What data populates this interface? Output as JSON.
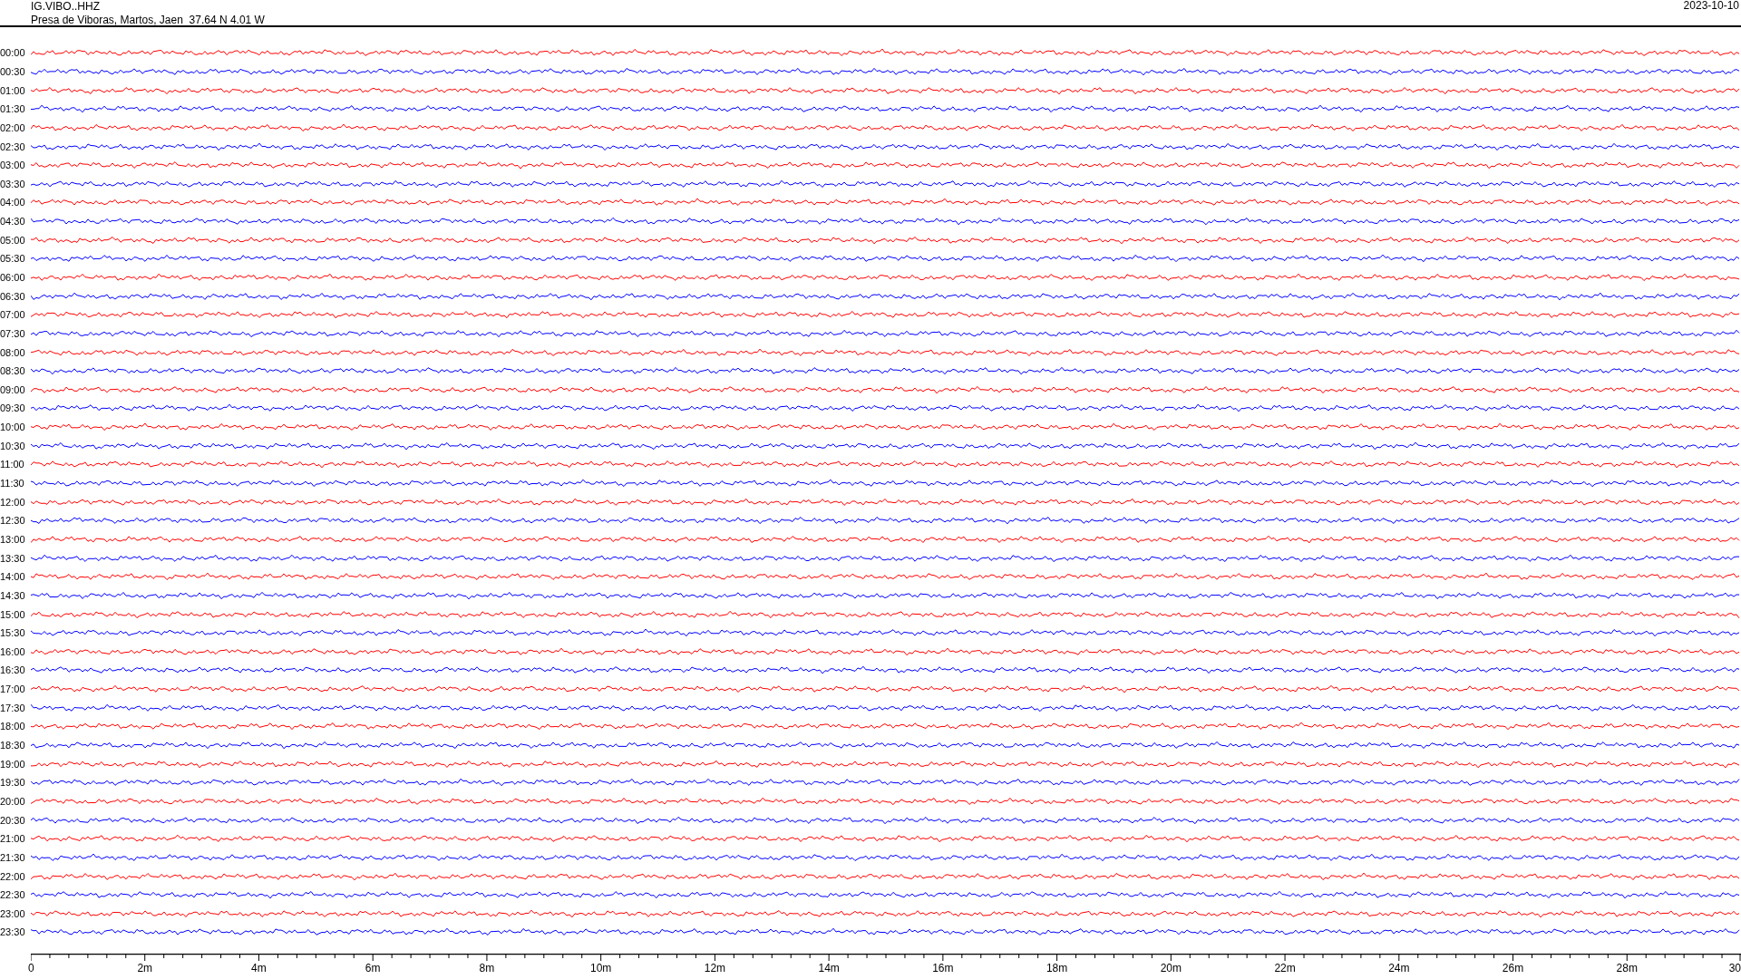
{
  "header": {
    "station": "IG.VIBO..HHZ",
    "location": "Presa de Viboras, Martos, Jaen  37.64 N 4.01 W",
    "date": "2023-10-10"
  },
  "rows": [
    {
      "time": "00:00",
      "color": "#ff0000"
    },
    {
      "time": "00:30",
      "color": "#0000ff"
    },
    {
      "time": "01:00",
      "color": "#ff0000"
    },
    {
      "time": "01:30",
      "color": "#0000ff"
    },
    {
      "time": "02:00",
      "color": "#ff0000"
    },
    {
      "time": "02:30",
      "color": "#0000ff"
    },
    {
      "time": "03:00",
      "color": "#ff0000"
    },
    {
      "time": "03:30",
      "color": "#0000ff"
    },
    {
      "time": "04:00",
      "color": "#ff0000"
    },
    {
      "time": "04:30",
      "color": "#0000ff"
    },
    {
      "time": "05:00",
      "color": "#ff0000"
    },
    {
      "time": "05:30",
      "color": "#0000ff"
    },
    {
      "time": "06:00",
      "color": "#ff0000"
    },
    {
      "time": "06:30",
      "color": "#0000ff"
    },
    {
      "time": "07:00",
      "color": "#ff0000"
    },
    {
      "time": "07:30",
      "color": "#0000ff"
    },
    {
      "time": "08:00",
      "color": "#ff0000"
    },
    {
      "time": "08:30",
      "color": "#0000ff"
    },
    {
      "time": "09:00",
      "color": "#ff0000"
    },
    {
      "time": "09:30",
      "color": "#0000ff"
    },
    {
      "time": "10:00",
      "color": "#ff0000"
    },
    {
      "time": "10:30",
      "color": "#0000ff"
    },
    {
      "time": "11:00",
      "color": "#ff0000"
    },
    {
      "time": "11:30",
      "color": "#0000ff"
    },
    {
      "time": "12:00",
      "color": "#ff0000"
    },
    {
      "time": "12:30",
      "color": "#0000ff"
    },
    {
      "time": "13:00",
      "color": "#ff0000"
    },
    {
      "time": "13:30",
      "color": "#0000ff"
    },
    {
      "time": "14:00",
      "color": "#ff0000"
    },
    {
      "time": "14:30",
      "color": "#0000ff"
    },
    {
      "time": "15:00",
      "color": "#ff0000"
    },
    {
      "time": "15:30",
      "color": "#0000ff"
    },
    {
      "time": "16:00",
      "color": "#ff0000"
    },
    {
      "time": "16:30",
      "color": "#0000ff"
    },
    {
      "time": "17:00",
      "color": "#ff0000"
    },
    {
      "time": "17:30",
      "color": "#0000ff"
    },
    {
      "time": "18:00",
      "color": "#ff0000"
    },
    {
      "time": "18:30",
      "color": "#0000ff"
    },
    {
      "time": "19:00",
      "color": "#ff0000"
    },
    {
      "time": "19:30",
      "color": "#0000ff"
    },
    {
      "time": "20:00",
      "color": "#ff0000"
    },
    {
      "time": "20:30",
      "color": "#0000ff"
    },
    {
      "time": "21:00",
      "color": "#ff0000"
    },
    {
      "time": "21:30",
      "color": "#0000ff"
    },
    {
      "time": "22:00",
      "color": "#ff0000"
    },
    {
      "time": "22:30",
      "color": "#0000ff"
    },
    {
      "time": "23:00",
      "color": "#ff0000"
    },
    {
      "time": "23:30",
      "color": "#0000ff"
    }
  ],
  "axis": {
    "ticks": [
      "0",
      "2m",
      "4m",
      "6m",
      "8m",
      "10m",
      "12m",
      "14m",
      "16m",
      "18m",
      "20m",
      "22m",
      "24m",
      "26m",
      "28m",
      "30"
    ]
  }
}
